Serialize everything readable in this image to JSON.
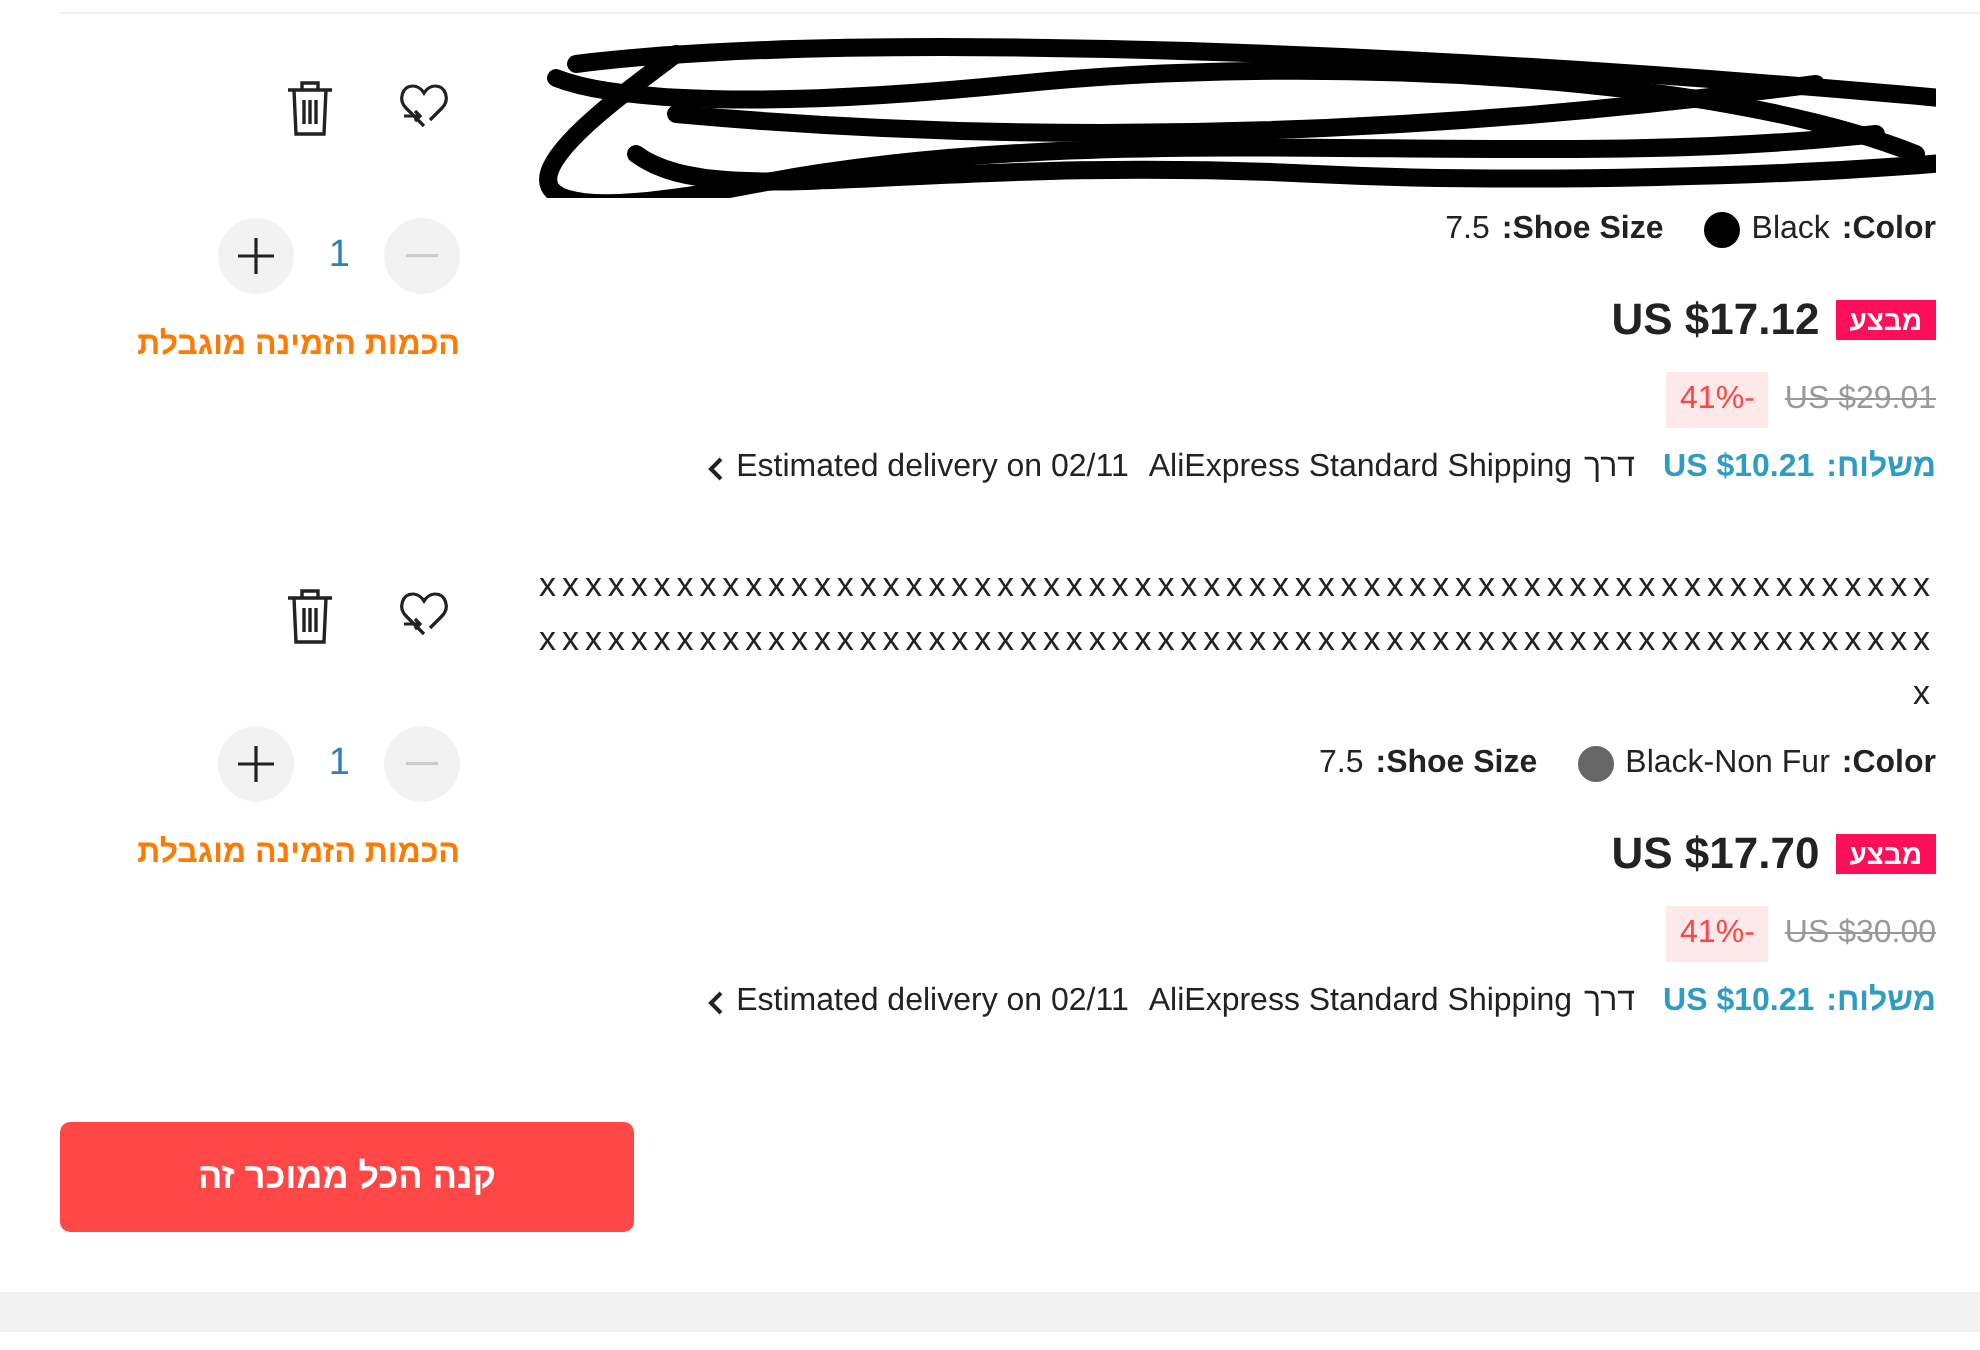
{
  "items": [
    {
      "title_redacted": true,
      "color_label": "Color:",
      "color_value": "Black",
      "color": "#000000",
      "size_label": "Shoe Size:",
      "size_value": "7.5",
      "quantity": "1",
      "stock_note": "הכמות הזמינה מוגבלת",
      "sale_badge": "מבצע",
      "price": "US $17.12",
      "original_price": "US $29.01",
      "discount": "-41%",
      "shipping_label": "משלוח:",
      "shipping_price": "US $10.21",
      "via": "דרך",
      "carrier": "AliExpress Standard Shipping",
      "delivery": "Estimated delivery on 02/11"
    },
    {
      "title_redacted": false,
      "title": "xxxxxxxxxxxxxxxxxxxxxxxxxxxxxxxxxxxxxxxxxxxxxxxxxxxxxxxxxxxxxxxxxxxxxxxxxxxxxxxxxxxxxxxxxxxxxxxxxxxxxxxxxxxxxxxxxxxxxxxxxxx",
      "color_label": "Color:",
      "color_value": "Black-Non Fur",
      "color": "#666666",
      "size_label": "Shoe Size:",
      "size_value": "7.5",
      "quantity": "1",
      "stock_note": "הכמות הזמינה מוגבלת",
      "sale_badge": "מבצע",
      "price": "US $17.70",
      "original_price": "US $30.00",
      "discount": "-41%",
      "shipping_label": "משלוח:",
      "shipping_price": "US $10.21",
      "via": "דרך",
      "carrier": "AliExpress Standard Shipping",
      "delivery": "Estimated delivery on 02/11"
    }
  ],
  "buy_button": "קנה הכל ממוכר זה"
}
